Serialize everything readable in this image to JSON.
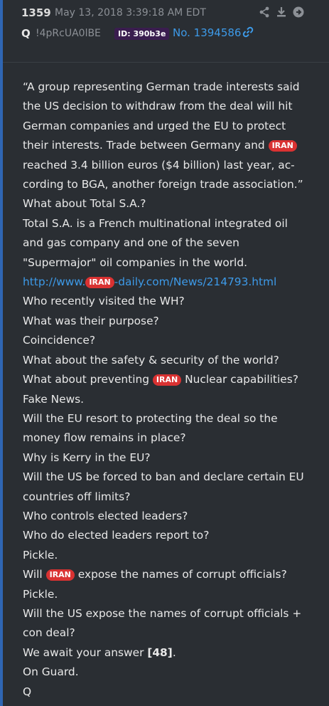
{
  "header": {
    "post_number": "1359",
    "date": "May 13, 2018 3:39:18 AM EDT",
    "name": "Q",
    "tripcode": "!4pRcUA0lBE",
    "id_badge": "ID: 390b3e",
    "reply_link": "No. 1394586",
    "icons": [
      "share-icon",
      "download-icon",
      "forward-icon",
      "link-icon"
    ]
  },
  "tag_text": "IRAN",
  "colors": {
    "accent": "#3d9ae8",
    "tag": "#d93232",
    "id_badge": "#3a1d4f",
    "left_bar": "#2f66b3"
  },
  "body": {
    "l01": "“A group representing German trade interests said",
    "l02": "the US decision to withdraw from the deal will hit",
    "l03": "German companies and urged the EU to protect",
    "l04a": "their interests. Trade between Germany and ",
    "l05": "reached 3.4 billion euros ($4 billion) last year, ac-",
    "l06": "cording to BGA, another foreign trade association.”",
    "l07": "What about Total S.A.?",
    "l08": "Total S.A. is a French multinational integrated oil",
    "l09": "and gas company and one of the seven",
    "l10": "\"Supermajor\" oil companies in the world.",
    "url_a": "http://www.",
    "url_b": "-daily.com/News/214793.html",
    "l12": "Who recently visited the WH?",
    "l13": "What was their purpose?",
    "l14": "Coincidence?",
    "l15": "What about the safety & security of the world?",
    "l16a": "What about preventing ",
    "l16b": " Nuclear capabilities?",
    "l17": "Fake News.",
    "l18": "Will the EU resort to protecting the deal so the",
    "l19": "money flow remains in place?",
    "l20": "Why is Kerry in the EU?",
    "l21": "Will the US be forced to ban and declare certain EU",
    "l22": "countries off limits?",
    "l23": "Who controls elected leaders?",
    "l24": "Who do elected leaders report to?",
    "l25": "Pickle.",
    "l26a": "Will ",
    "l26b": " expose the names of corrupt officials?",
    "l27": "Pickle.",
    "l28": "Will the US expose the names of corrupt officials +",
    "l29": "con deal?",
    "l30a": "We await your answer ",
    "l30b": "[48]",
    "l30c": ".",
    "l31": "On Guard.",
    "l32": "Q"
  }
}
